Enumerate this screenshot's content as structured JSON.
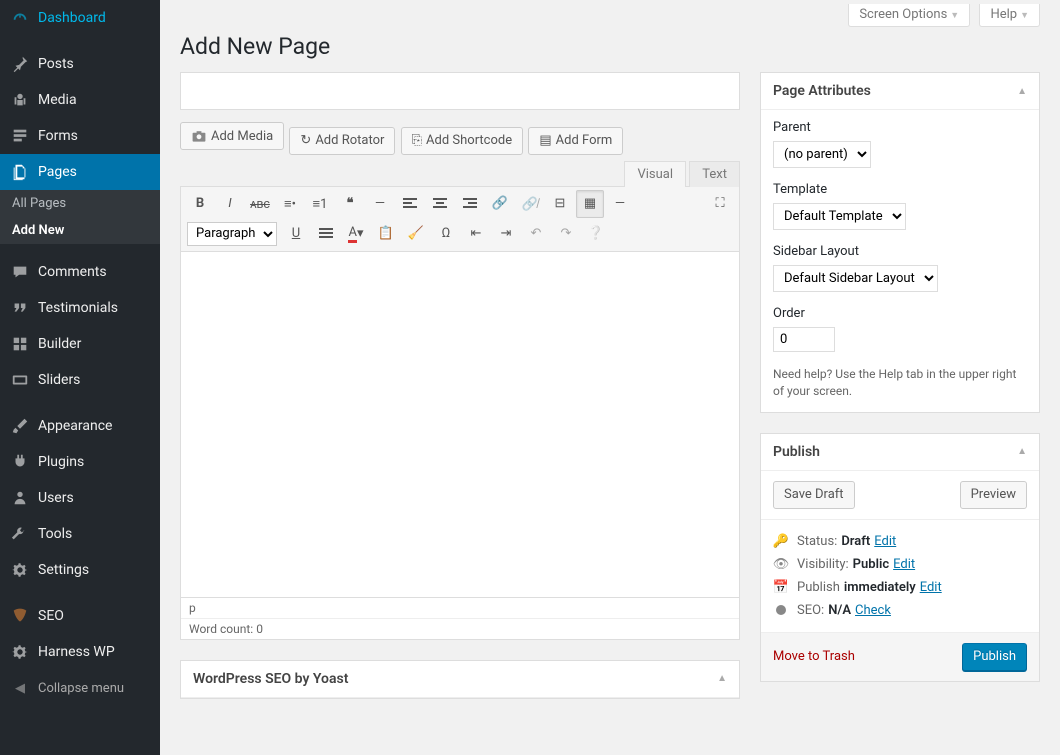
{
  "screen_meta": {
    "options": "Screen Options",
    "help": "Help"
  },
  "heading": "Add New Page",
  "title_placeholder": "",
  "sidebar": {
    "items": [
      {
        "label": "Dashboard",
        "icon": "dashboard"
      },
      {
        "label": "Posts",
        "icon": "pin"
      },
      {
        "label": "Media",
        "icon": "media"
      },
      {
        "label": "Forms",
        "icon": "forms"
      },
      {
        "label": "Pages",
        "icon": "page",
        "current": true
      },
      {
        "label": "Comments",
        "icon": "comment"
      },
      {
        "label": "Testimonials",
        "icon": "quote"
      },
      {
        "label": "Builder",
        "icon": "grid"
      },
      {
        "label": "Sliders",
        "icon": "sliders"
      },
      {
        "label": "Appearance",
        "icon": "brush"
      },
      {
        "label": "Plugins",
        "icon": "plug"
      },
      {
        "label": "Users",
        "icon": "user"
      },
      {
        "label": "Tools",
        "icon": "wrench"
      },
      {
        "label": "Settings",
        "icon": "gear"
      },
      {
        "label": "SEO",
        "icon": "seo"
      },
      {
        "label": "Harness WP",
        "icon": "gear"
      }
    ],
    "submenu": [
      {
        "label": "All Pages"
      },
      {
        "label": "Add New",
        "current": true
      }
    ],
    "collapse": "Collapse menu"
  },
  "media_buttons": {
    "add_media": "Add Media",
    "add_rotator": "Add Rotator",
    "add_shortcode": "Add Shortcode",
    "add_form": "Add Form"
  },
  "editor": {
    "tabs": {
      "visual": "Visual",
      "text": "Text"
    },
    "format_select": "Paragraph",
    "path": "p",
    "word_count_label": "Word count: ",
    "word_count": "0"
  },
  "page_attributes": {
    "title": "Page Attributes",
    "parent_label": "Parent",
    "parent_value": "(no parent)",
    "template_label": "Template",
    "template_value": "Default Template",
    "sidebar_label": "Sidebar Layout",
    "sidebar_value": "Default Sidebar Layout",
    "order_label": "Order",
    "order_value": "0",
    "help": "Need help? Use the Help tab in the upper right of your screen."
  },
  "publish": {
    "title": "Publish",
    "save_draft": "Save Draft",
    "preview": "Preview",
    "status_label": "Status:",
    "status_value": "Draft",
    "visibility_label": "Visibility:",
    "visibility_value": "Public",
    "schedule_label": "Publish",
    "schedule_value": "immediately",
    "seo_label": "SEO:",
    "seo_value": "N/A",
    "edit": "Edit",
    "check": "Check",
    "trash": "Move to Trash",
    "publish_btn": "Publish"
  },
  "yoast": {
    "title": "WordPress SEO by Yoast"
  }
}
